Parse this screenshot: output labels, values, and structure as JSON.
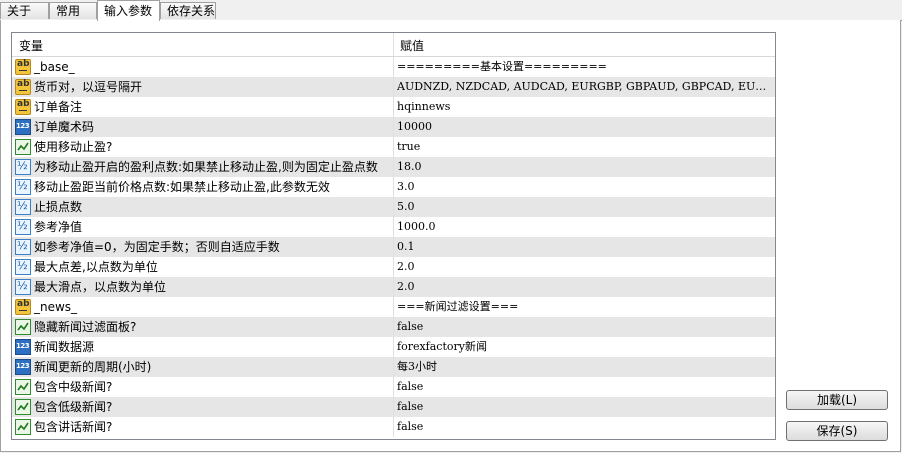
{
  "tabs": [
    {
      "label": "关于"
    },
    {
      "label": "常用"
    },
    {
      "label": "输入参数"
    },
    {
      "label": "依存关系"
    }
  ],
  "grid": {
    "columns": {
      "variable": "变量",
      "value": "赋值"
    },
    "rows": [
      {
        "type": "string",
        "name": "_base_",
        "value": "=========基本设置========="
      },
      {
        "type": "string",
        "name": "货币对，以逗号隔开",
        "value": "AUDNZD, NZDCAD, AUDCAD, EURGBP, GBPAUD, GBPCAD, EURCAD, USDCAD, EUR..."
      },
      {
        "type": "string",
        "name": "订单备注",
        "value": "hqinnews"
      },
      {
        "type": "int",
        "name": "订单魔术码",
        "value": "10000"
      },
      {
        "type": "bool",
        "name": "使用移动止盈?",
        "value": "true"
      },
      {
        "type": "double",
        "name": "为移动止盈开启的盈利点数:如果禁止移动止盈,则为固定止盈点数",
        "value": "18.0"
      },
      {
        "type": "double",
        "name": "移动止盈距当前价格点数:如果禁止移动止盈,此参数无效",
        "value": "3.0"
      },
      {
        "type": "double",
        "name": "止损点数",
        "value": "5.0"
      },
      {
        "type": "double",
        "name": "参考净值",
        "value": "1000.0"
      },
      {
        "type": "double",
        "name": "如参考净值=0，为固定手数；否则自适应手数",
        "value": "0.1"
      },
      {
        "type": "double",
        "name": "最大点差,以点数为单位",
        "value": "2.0"
      },
      {
        "type": "double",
        "name": "最大滑点，以点数为单位",
        "value": "2.0"
      },
      {
        "type": "string",
        "name": "_news_",
        "value": "===新闻过滤设置==="
      },
      {
        "type": "bool",
        "name": "隐藏新闻过滤面板?",
        "value": "false"
      },
      {
        "type": "int",
        "name": "新闻数据源",
        "value": "forexfactory新闻"
      },
      {
        "type": "int",
        "name": "新闻更新的周期(小时)",
        "value": "每3小时"
      },
      {
        "type": "bool",
        "name": "包含中级新闻?",
        "value": "false"
      },
      {
        "type": "bool",
        "name": "包含低级新闻?",
        "value": "false"
      },
      {
        "type": "bool",
        "name": "包含讲话新闻?",
        "value": "false"
      }
    ]
  },
  "buttons": {
    "load": "加载(L)",
    "save": "保存(S)"
  }
}
